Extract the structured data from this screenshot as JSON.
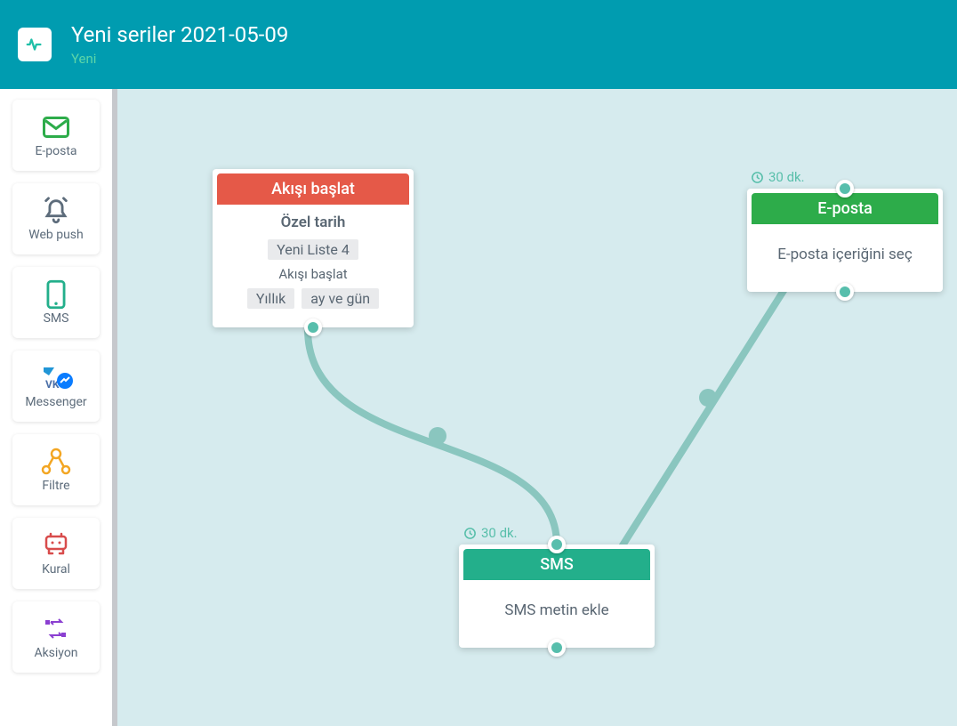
{
  "header": {
    "title": "Yeni seriler 2021-05-09",
    "subtitle": "Yeni"
  },
  "sidebar": {
    "items": [
      {
        "label": "E-posta"
      },
      {
        "label": "Web push"
      },
      {
        "label": "SMS"
      },
      {
        "label": "Messenger"
      },
      {
        "label": "Filtre"
      },
      {
        "label": "Kural"
      },
      {
        "label": "Aksiyon"
      }
    ]
  },
  "nodes": {
    "start": {
      "header": "Akışı başlat",
      "title": "Özel tarih",
      "list_tag": "Yeni Liste 4",
      "subtitle": "Akışı başlat",
      "tag1": "Yıllık",
      "tag2": "ay ve gün"
    },
    "sms": {
      "header": "SMS",
      "body": "SMS metin ekle",
      "delay": "30 dk."
    },
    "email": {
      "header": "E-posta",
      "body": "E-posta içeriğini seç",
      "delay": "30 dk."
    }
  },
  "colors": {
    "start_header": "#e55948",
    "sms_header": "#23af8b",
    "email_header": "#2dac4a"
  }
}
